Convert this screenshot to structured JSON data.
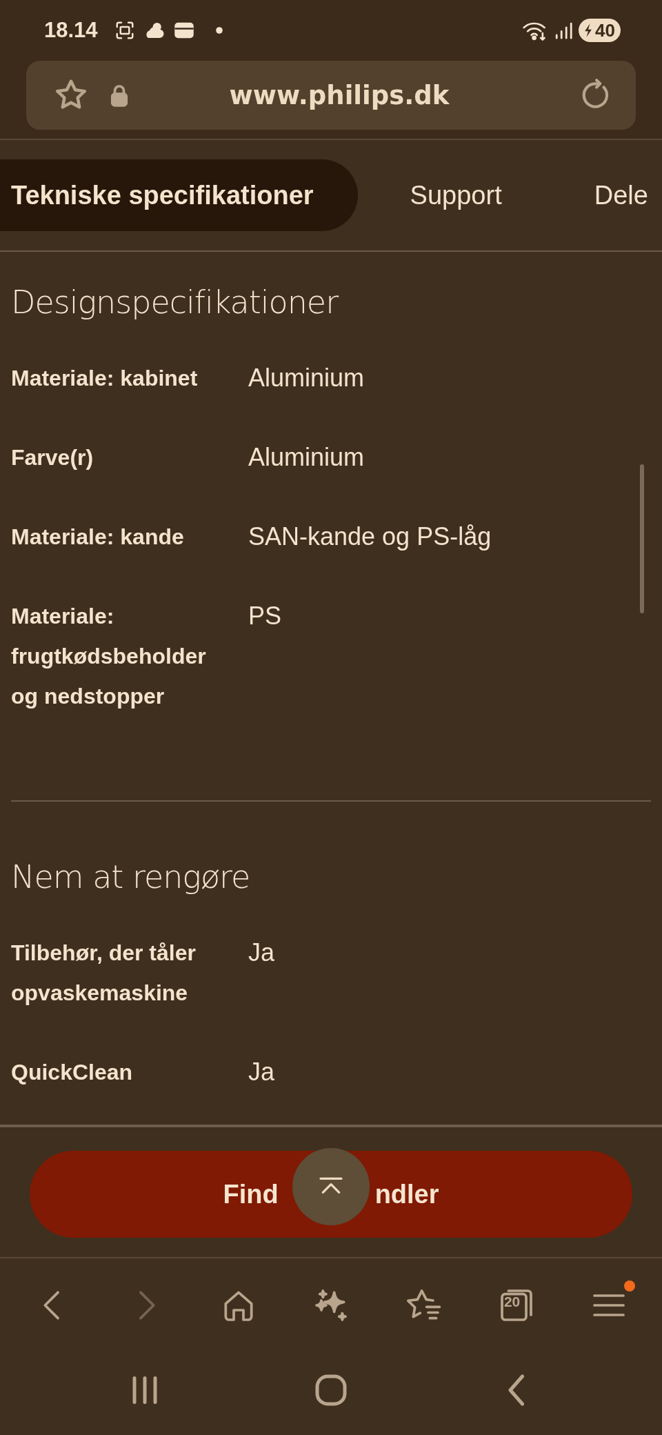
{
  "status_bar": {
    "time": "18.14",
    "battery": "40"
  },
  "address_bar": {
    "url": "www.philips.dk"
  },
  "tabs": [
    {
      "label": "Tekniske specifikationer",
      "selected": true
    },
    {
      "label": "Support",
      "selected": false
    },
    {
      "label": "Dele",
      "selected": false
    }
  ],
  "sections": [
    {
      "title": "Designspecifikationer",
      "rows": [
        {
          "label": "Materiale: kabinet",
          "value": "Aluminium"
        },
        {
          "label": "Farve(r)",
          "value": "Aluminium"
        },
        {
          "label": "Materiale: kande",
          "value": "SAN-kande og PS-låg"
        },
        {
          "label": "Materiale: frugtkødsbeholder og nedstopper",
          "value": "PS"
        }
      ]
    },
    {
      "title": "Nem at rengøre",
      "rows": [
        {
          "label": "Tilbehør, der tåler opvaskemaskine",
          "value": "Ja"
        },
        {
          "label": "QuickClean",
          "value": "Ja"
        }
      ]
    }
  ],
  "action_button": {
    "label_parts": [
      "Find",
      "ndler"
    ]
  },
  "browser_toolbar": [
    {
      "kind": "back",
      "disabled": false
    },
    {
      "kind": "forward",
      "disabled": true
    },
    {
      "kind": "home",
      "disabled": false
    },
    {
      "kind": "assistant",
      "disabled": false
    },
    {
      "kind": "bookmarks",
      "disabled": false
    },
    {
      "kind": "tabs",
      "disabled": false,
      "count": "20"
    },
    {
      "kind": "menu",
      "disabled": false,
      "badge": true
    }
  ],
  "system_nav": [
    {
      "kind": "recents"
    },
    {
      "kind": "home"
    },
    {
      "kind": "back"
    }
  ]
}
